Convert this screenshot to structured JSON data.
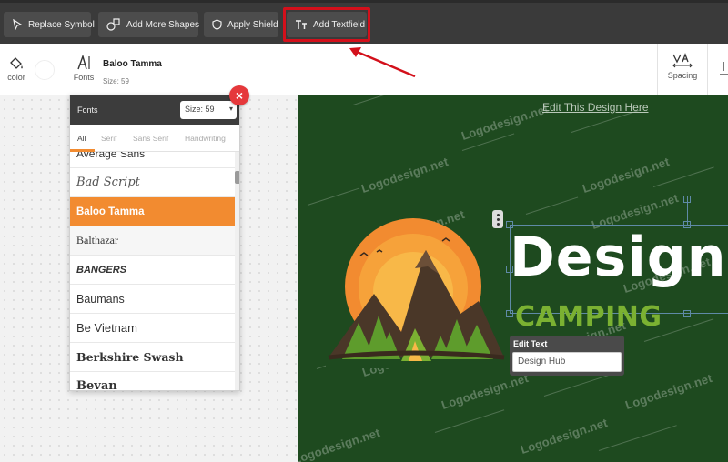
{
  "toolbar": {
    "replace_symbol": "Replace Symbol",
    "add_more_shapes": "Add More Shapes",
    "apply_shield": "Apply Shield",
    "add_textfield": "Add Textfield"
  },
  "subbar": {
    "color_label": "color",
    "fonts_label": "Fonts",
    "current_font": "Baloo Tamma",
    "size_text": "Size: 59",
    "spacing_label": "Spacing"
  },
  "fonts_panel": {
    "title": "Fonts",
    "size_select": "Size: 59",
    "tabs": [
      "All",
      "Serif",
      "Sans Serif",
      "Handwriting"
    ],
    "items": [
      "Average Sans",
      "Bad Script",
      "Baloo Tamma",
      "Balthazar",
      "BANGERS",
      "Baumans",
      "Be Vietnam",
      "Berkshire Swash",
      "Bevan"
    ],
    "selected": "Baloo Tamma"
  },
  "canvas": {
    "edit_link": "Edit This Design Here",
    "watermark": "Logodesign.net",
    "design_text": "Design",
    "camping_text": "CAMPING",
    "edit_text_title": "Edit Text",
    "edit_text_value": "Design Hub"
  },
  "colors": {
    "toolbar_bg": "#3a3a3a",
    "highlight": "#d3101b",
    "canvas_bg": "#1e4a1f",
    "accent_orange": "#f28b30",
    "camping_green": "#7bb132",
    "close_red": "#e5383b"
  },
  "icons": {
    "replace_symbol": "cursor-icon",
    "add_more_shapes": "shapes-icon",
    "apply_shield": "shield-icon",
    "add_textfield": "text-icon",
    "color": "paint-bucket-icon",
    "fonts": "font-icon",
    "spacing": "letter-spacing-icon",
    "close": "close-icon"
  }
}
